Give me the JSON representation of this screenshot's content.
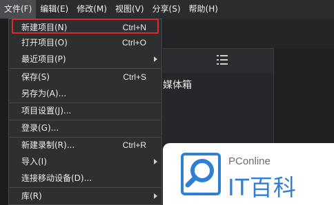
{
  "menubar": {
    "items": [
      {
        "label": "文件(F)"
      },
      {
        "label": "编辑(E)"
      },
      {
        "label": "修改(M)"
      },
      {
        "label": "视图(V)"
      },
      {
        "label": "分享(S)"
      },
      {
        "label": "帮助(H)"
      }
    ]
  },
  "file_menu": {
    "items": [
      {
        "label": "新建项目(N)",
        "shortcut": "Ctrl+N"
      },
      {
        "label": "打开项目(O)",
        "shortcut": "Ctrl+O"
      },
      {
        "label": "最近项目(P)",
        "submenu": true
      },
      {
        "label": "保存(S)",
        "shortcut": "Ctrl+S"
      },
      {
        "label": "另存为(A)..."
      },
      {
        "label": "项目设置(J)..."
      },
      {
        "label": "登录(G)..."
      },
      {
        "label": "新建录制(R)...",
        "shortcut": "Ctrl+R"
      },
      {
        "label": "导入(I)",
        "submenu": true
      },
      {
        "label": "连接移动设备(D)..."
      },
      {
        "label": "库(R)",
        "submenu": true
      }
    ]
  },
  "panel": {
    "title": "媒体箱"
  },
  "watermark": {
    "brand": "PConline",
    "name": "IT百科",
    "color": "#2f7fd4"
  },
  "colors": {
    "highlight": "#e2262a",
    "menu_bg": "#2e2f31"
  }
}
